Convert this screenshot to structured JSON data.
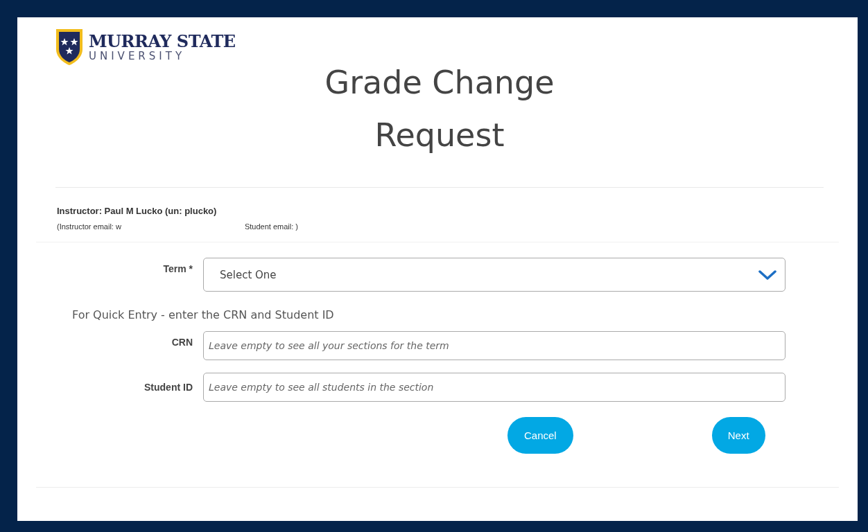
{
  "logo": {
    "name": "MURRAY STATE",
    "subtitle": "UNIVERSITY"
  },
  "title": "Grade Change Request",
  "instructor": {
    "line": "Instructor: Paul M Lucko (un: plucko)",
    "email_prefix": "(Instructor email: w",
    "email_suffix": "Student email: )"
  },
  "form": {
    "term": {
      "label": "Term *",
      "value": "Select One"
    },
    "quick_entry_note": "For Quick Entry - enter the CRN and Student ID",
    "fields": [
      {
        "label": "CRN",
        "placeholder": "Leave empty to see all your sections for the term"
      },
      {
        "label": "Student ID",
        "placeholder": "Leave empty to see all students in the section"
      }
    ],
    "buttons": [
      "Cancel",
      "Next"
    ]
  }
}
